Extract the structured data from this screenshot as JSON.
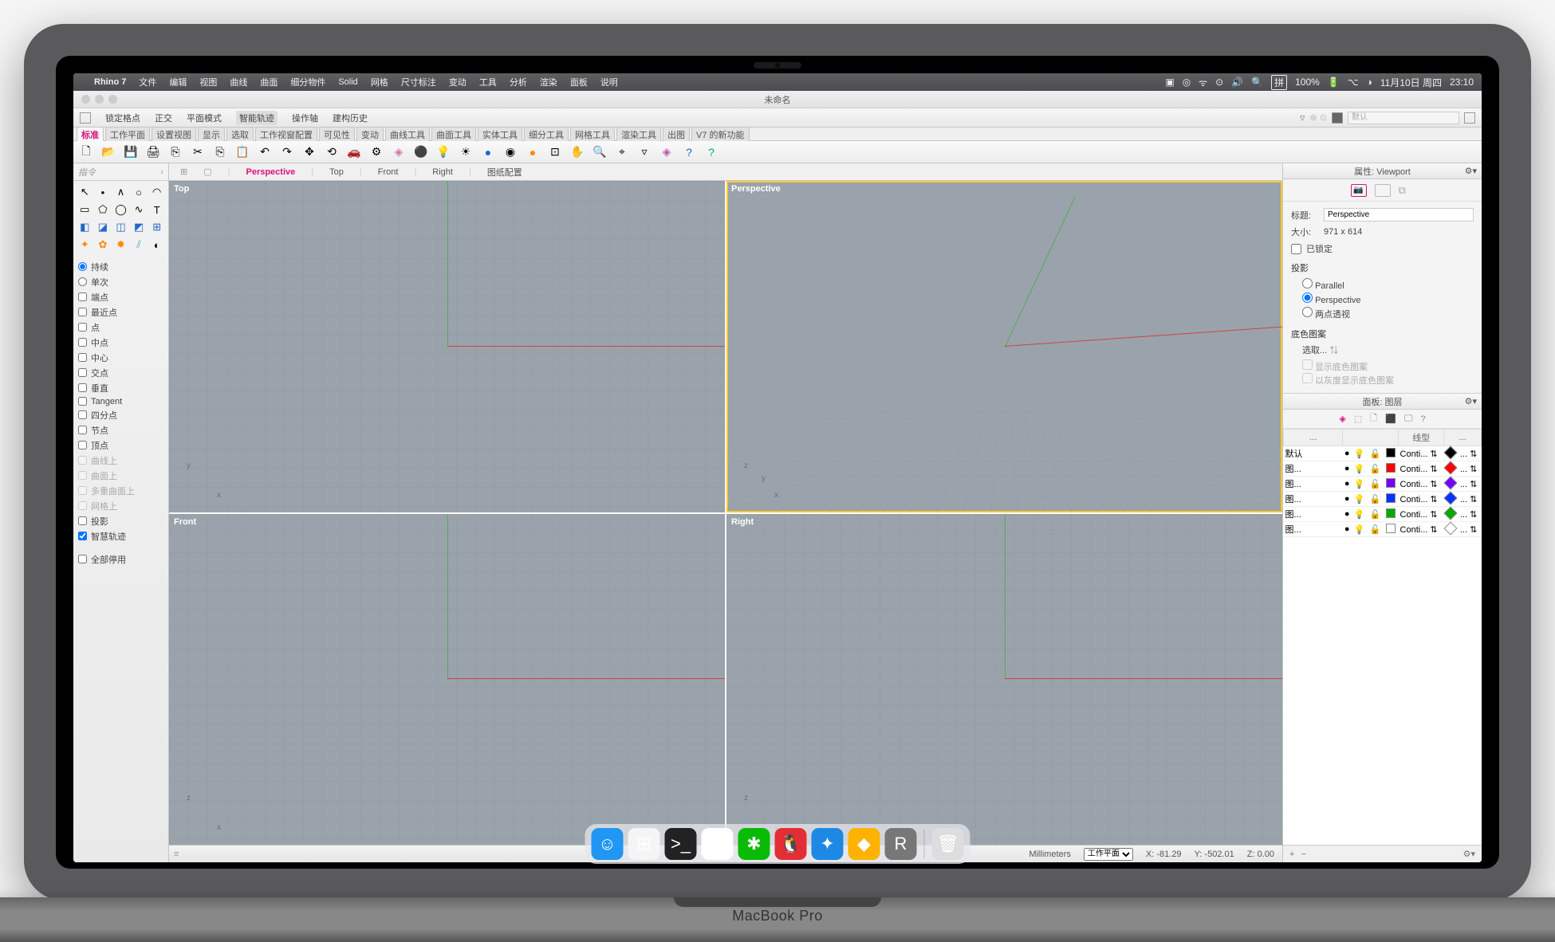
{
  "menubar": {
    "app_name": "Rhino 7",
    "items": [
      "文件",
      "编辑",
      "视图",
      "曲线",
      "曲面",
      "细分物件",
      "Solid",
      "网格",
      "尺寸标注",
      "变动",
      "工具",
      "分析",
      "渲染",
      "面板",
      "说明"
    ],
    "battery": "100%",
    "input_method": "拼",
    "date": "11月10日 周四",
    "time": "23:10"
  },
  "window": {
    "title": "未命名"
  },
  "top_toolbar": {
    "items": [
      "锁定格点",
      "正交",
      "平面模式",
      "智能轨迹",
      "操作轴",
      "建构历史"
    ],
    "search_placeholder": "默认"
  },
  "tab_strip": [
    "标准",
    "工作平面",
    "设置视图",
    "显示",
    "选取",
    "工作视窗配置",
    "可见性",
    "变动",
    "曲线工具",
    "曲面工具",
    "实体工具",
    "细分工具",
    "网格工具",
    "渲染工具",
    "出图",
    "V7 的新功能"
  ],
  "viewport_tabs": [
    "Perspective",
    "Top",
    "Front",
    "Right",
    "图纸配置"
  ],
  "left_panel": {
    "command_placeholder": "指令",
    "osnap": [
      {
        "label": "持续",
        "checked": false,
        "radio": true,
        "active": true
      },
      {
        "label": "单次",
        "checked": false,
        "radio": true
      },
      {
        "label": "端点",
        "checked": false
      },
      {
        "label": "最近点",
        "checked": false
      },
      {
        "label": "点",
        "checked": false
      },
      {
        "label": "中点",
        "checked": false
      },
      {
        "label": "中心",
        "checked": false
      },
      {
        "label": "交点",
        "checked": false
      },
      {
        "label": "垂直",
        "checked": false
      },
      {
        "label": "Tangent",
        "checked": false
      },
      {
        "label": "四分点",
        "checked": false
      },
      {
        "label": "节点",
        "checked": false
      },
      {
        "label": "顶点",
        "checked": false
      },
      {
        "label": "曲线上",
        "checked": false,
        "disabled": true
      },
      {
        "label": "曲面上",
        "checked": false,
        "disabled": true
      },
      {
        "label": "多重曲面上",
        "checked": false,
        "disabled": true
      },
      {
        "label": "网格上",
        "checked": false,
        "disabled": true
      },
      {
        "label": "投影",
        "checked": false
      },
      {
        "label": "智慧轨迹",
        "checked": true
      },
      {
        "label": "全部停用",
        "checked": false,
        "gap": true
      }
    ]
  },
  "viewports": {
    "top_left": "Top",
    "top_right": "Perspective",
    "bottom_left": "Front",
    "bottom_right": "Right",
    "active": "top_right"
  },
  "status_bar": {
    "units": "Millimeters",
    "cplane": "工作平面",
    "x_label": "X:",
    "x": "-81.29",
    "y_label": "Y:",
    "y": "-502.01",
    "z_label": "Z:",
    "z": "0.00"
  },
  "properties_panel": {
    "header": "属性: Viewport",
    "title_label": "标题:",
    "title_value": "Perspective",
    "size_label": "大小:",
    "size_value": "971 x 614",
    "locked_label": "已锁定",
    "projection_label": "投影",
    "projection_options": [
      "Parallel",
      "Perspective",
      "两点透视"
    ],
    "projection_selected": "Perspective",
    "wallpaper_label": "底色图案",
    "select_label": "选取...",
    "show_wallpaper": "显示底色图案",
    "gray_wallpaper": "以灰度显示底色图案"
  },
  "layers_panel": {
    "header": "面板: 图层",
    "col1": "...",
    "col2": "线型",
    "col3": "...",
    "rows": [
      {
        "name": "默认",
        "color": "#000000",
        "linetype": "Conti...",
        "print": "#000000"
      },
      {
        "name": "图...",
        "color": "#ff0000",
        "linetype": "Conti...",
        "print": "#ff0000"
      },
      {
        "name": "图...",
        "color": "#7700ff",
        "linetype": "Conti...",
        "print": "#7700ff"
      },
      {
        "name": "图...",
        "color": "#0033ff",
        "linetype": "Conti...",
        "print": "#0033ff"
      },
      {
        "name": "图...",
        "color": "#00aa00",
        "linetype": "Conti...",
        "print": "#00aa00"
      },
      {
        "name": "图...",
        "color": "#ffffff",
        "linetype": "Conti...",
        "print": "#ffffff"
      }
    ]
  },
  "dock": {
    "apps": [
      {
        "name": "finder",
        "color": "#2196f3",
        "glyph": "☺"
      },
      {
        "name": "launchpad",
        "color": "#f5f5f5",
        "glyph": "⊞"
      },
      {
        "name": "terminal",
        "color": "#222",
        "glyph": ">_"
      },
      {
        "name": "chrome",
        "color": "#fff",
        "glyph": "◎"
      },
      {
        "name": "wechat",
        "color": "#09bb07",
        "glyph": "✱"
      },
      {
        "name": "qq",
        "color": "#e32e36",
        "glyph": "🐧"
      },
      {
        "name": "safari",
        "color": "#1e88e5",
        "glyph": "✦"
      },
      {
        "name": "sketch",
        "color": "#fdb300",
        "glyph": "◆"
      },
      {
        "name": "rhino",
        "color": "#777",
        "glyph": "R"
      }
    ],
    "trash": "🗑"
  }
}
